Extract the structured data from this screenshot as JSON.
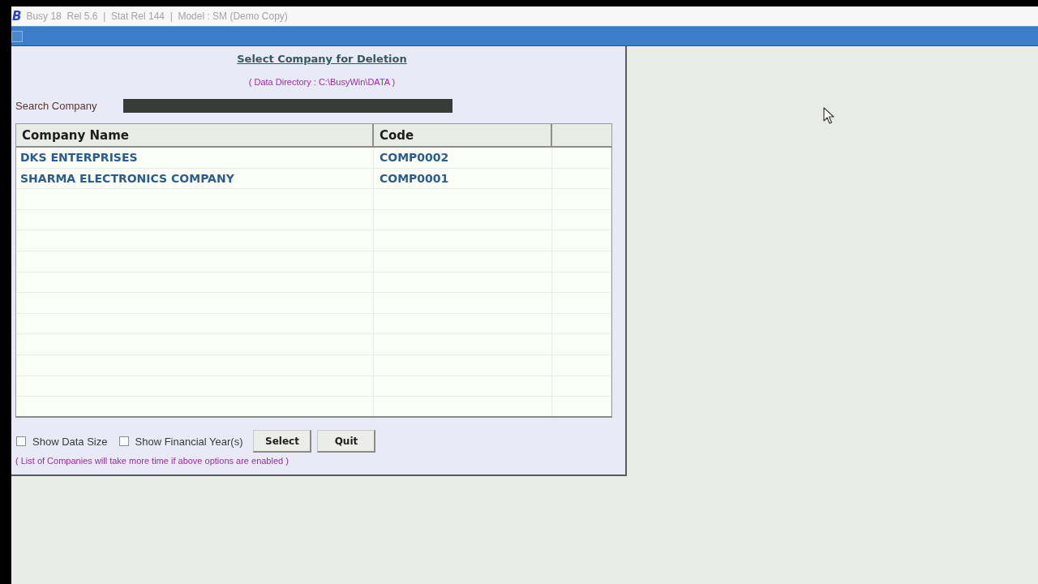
{
  "window": {
    "logo": "B",
    "title": "Busy 18  Rel 5.6  |  Stat Rel 144  |  Model : SM (Demo Copy)"
  },
  "dialog": {
    "title": "Select Company for Deletion",
    "subtitle": "( Data Directory : C:\\BusyWin\\DATA )",
    "search": {
      "label": "Search Company"
    },
    "table": {
      "columns": [
        "Company Name",
        "Code"
      ],
      "rows": [
        {
          "name": "DKS ENTERPRISES",
          "code": "COMP0002",
          "selected": false
        },
        {
          "name": "SHARMA ELECTRONICS COMPANY",
          "code": "COMP0001",
          "selected": false
        }
      ]
    },
    "options": [
      {
        "label": "Show Data Size",
        "checked": false
      },
      {
        "label": "Show Financial Year(s)",
        "checked": false
      }
    ],
    "buttons": [
      "Select",
      "Quit"
    ],
    "note": "( List of Companies will take more time if above options are enabled )"
  }
}
